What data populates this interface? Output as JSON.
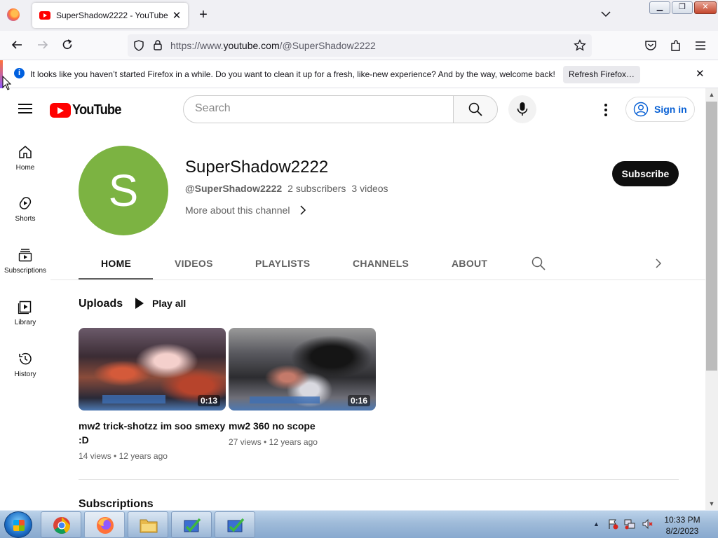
{
  "browser": {
    "tab_title": "SuperShadow2222 - YouTube",
    "url_prefix": "https://www.",
    "url_domain": "youtube.com",
    "url_path": "/@SuperShadow2222",
    "notification": {
      "message": "It looks like you haven’t started Firefox in a while. Do you want to clean it up for a fresh, like-new experience? And by the way, welcome back!",
      "button_label": "Refresh Firefox…"
    }
  },
  "youtube": {
    "logo_text": "YouTube",
    "search_placeholder": "Search",
    "sign_in_label": "Sign in",
    "guide": [
      {
        "label": "Home",
        "icon": "home-icon"
      },
      {
        "label": "Shorts",
        "icon": "shorts-icon"
      },
      {
        "label": "Subscriptions",
        "icon": "subscriptions-icon"
      },
      {
        "label": "Library",
        "icon": "library-icon"
      },
      {
        "label": "History",
        "icon": "history-icon"
      }
    ]
  },
  "channel": {
    "avatar_letter": "S",
    "avatar_color": "#7cb342",
    "name": "SuperShadow2222",
    "handle": "@SuperShadow2222",
    "subscribers": "2 subscribers",
    "videos": "3 videos",
    "more_about": "More about this channel",
    "subscribe_label": "Subscribe",
    "tabs": [
      "HOME",
      "VIDEOS",
      "PLAYLISTS",
      "CHANNELS",
      "ABOUT"
    ],
    "active_tab": "HOME"
  },
  "uploads": {
    "title": "Uploads",
    "play_all_label": "Play all",
    "videos": [
      {
        "title": "mw2 trick-shotzz im soo smexy :D",
        "duration": "0:13",
        "views": "14 views",
        "age": "12 years ago"
      },
      {
        "title": "mw2 360 no scope",
        "duration": "0:16",
        "views": "27 views",
        "age": "12 years ago"
      }
    ]
  },
  "next_shelf": {
    "title": "Subscriptions"
  },
  "taskbar": {
    "time": "10:33 PM",
    "date": "8/2/2023"
  }
}
